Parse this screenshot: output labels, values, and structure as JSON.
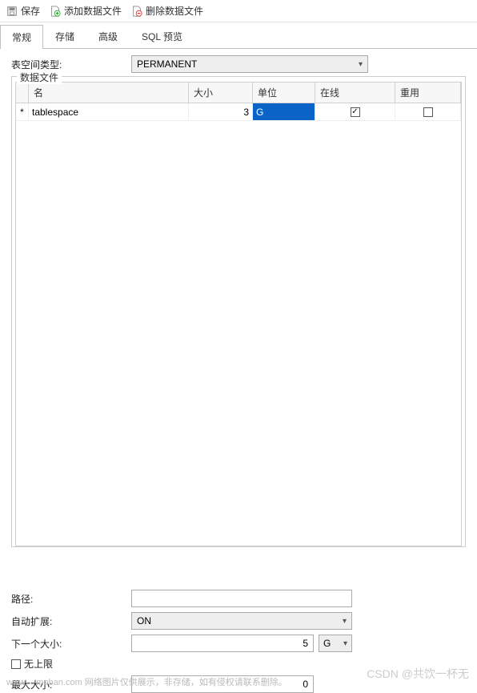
{
  "toolbar": {
    "save": "保存",
    "add_file": "添加数据文件",
    "del_file": "删除数据文件"
  },
  "tabs": {
    "general": "常规",
    "storage": "存储",
    "advanced": "高级",
    "sql_preview": "SQL 预览"
  },
  "form": {
    "type_label": "表空间类型:",
    "type_value": "PERMANENT"
  },
  "datafiles": {
    "legend": "数据文件",
    "headers": {
      "name": "名",
      "size": "大小",
      "unit": "单位",
      "online": "在线",
      "reuse": "重用"
    },
    "rows": [
      {
        "marker": "*",
        "name": "tablespace",
        "size": "3",
        "unit": "G",
        "online": true,
        "reuse": false
      }
    ]
  },
  "bottom": {
    "path_label": "路径:",
    "path_value": "",
    "autoext_label": "自动扩展:",
    "autoext_value": "ON",
    "next_label": "下一个大小:",
    "next_value": "5",
    "next_unit": "G",
    "unlimited_label": "无上限",
    "max_label": "最大大小:",
    "max_value": "0"
  },
  "watermark": "www.---moban.com  网络图片仅供展示，非存储，如有侵权请联系删除。",
  "watermark2": "CSDN @共饮一杯无"
}
